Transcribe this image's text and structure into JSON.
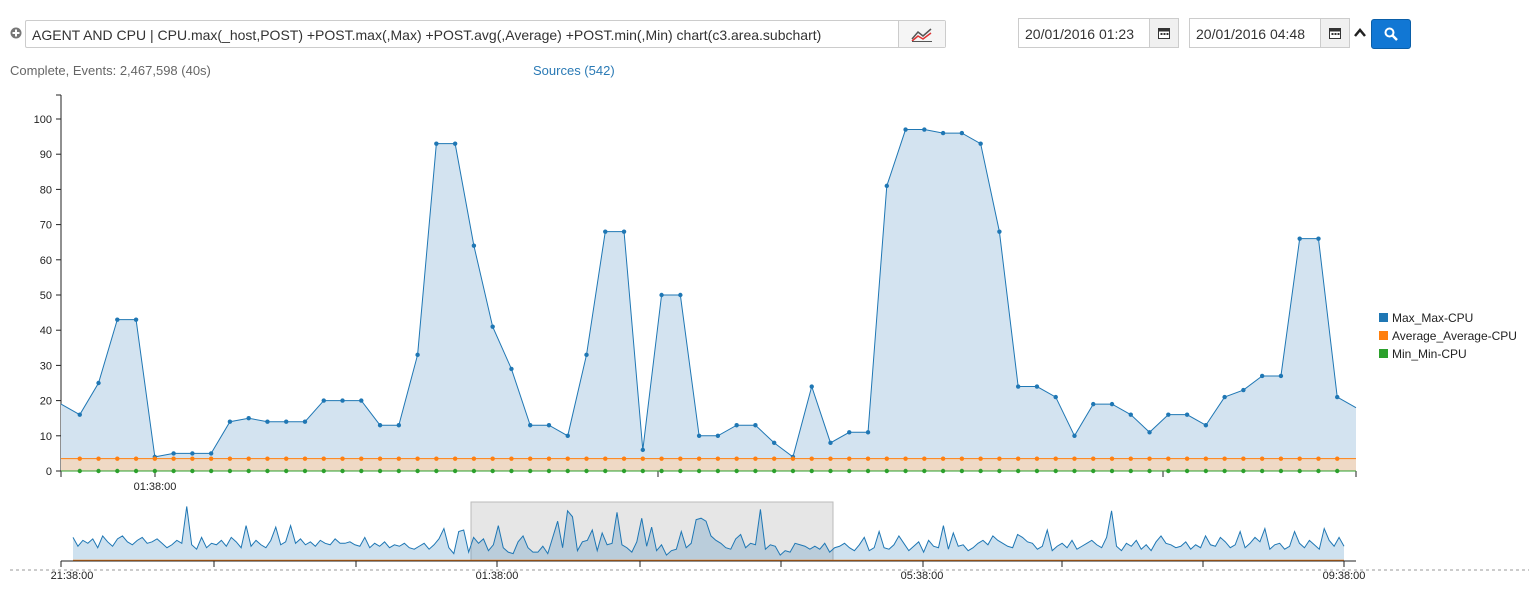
{
  "query": {
    "text": "AGENT AND CPU | CPU.max(_host,POST) +POST.max(,Max) +POST.avg(,Average) +POST.min(,Min) chart(c3.area.subchart)"
  },
  "date_range": {
    "start": "20/01/2016 01:23",
    "end": "20/01/2016 04:48"
  },
  "status": {
    "complete_text": "Complete, Events: 2,467,598 (40s)",
    "sources_link": "Sources (542)"
  },
  "colors": {
    "max": "#1f77b4",
    "avg": "#ff7f0e",
    "min": "#2ca02c",
    "max_fill": "#d3e3f0",
    "search_button": "#1177d4"
  },
  "icons": [
    "plus-circle-icon",
    "line-chart-icon",
    "calendar-icon",
    "chevron-up-icon",
    "search-icon"
  ],
  "chart_data": {
    "type": "area",
    "subchart": true,
    "ylim": [
      0,
      100
    ],
    "y_ticks": [
      0,
      10,
      20,
      30,
      40,
      50,
      60,
      70,
      80,
      90,
      100
    ],
    "x_tick_labels": [
      "01:38:00"
    ],
    "subchart_tick_labels": [
      "21:38:00",
      "01:38:00",
      "05:38:00",
      "09:38:00"
    ],
    "legend_position": "right",
    "series": [
      {
        "name": "Max_Max-CPU",
        "values": [
          19,
          16,
          25,
          43,
          43,
          4,
          5,
          5,
          5,
          14,
          15,
          14,
          14,
          14,
          20,
          20,
          20,
          13,
          13,
          33,
          93,
          93,
          64,
          41,
          29,
          13,
          13,
          10,
          33,
          68,
          68,
          6,
          50,
          50,
          10,
          10,
          13,
          13,
          8,
          4,
          24,
          8,
          11,
          11,
          81,
          97,
          97,
          96,
          96,
          93,
          68,
          24,
          24,
          21,
          10,
          19,
          19,
          16,
          11,
          16,
          16,
          13,
          21,
          23,
          27,
          27,
          66,
          66,
          21,
          18
        ]
      },
      {
        "name": "Average_Average-CPU",
        "values": [
          3.5,
          3.5,
          3.5,
          3.5,
          3.5,
          3.5,
          3.5,
          3.5,
          3.5,
          3.5,
          3.5,
          3.5,
          3.5,
          3.5,
          3.5,
          3.5,
          3.5,
          3.5,
          3.5,
          3.5,
          3.5,
          3.5,
          3.5,
          3.5,
          3.5,
          3.5,
          3.5,
          3.5,
          3.5,
          3.5,
          3.5,
          3.5,
          3.5,
          3.5,
          3.5,
          3.5,
          3.5,
          3.5,
          3.5,
          3.5,
          3.5,
          3.5,
          3.5,
          3.5,
          3.5,
          3.5,
          3.5,
          3.5,
          3.5,
          3.5,
          3.5,
          3.5,
          3.5,
          3.5,
          3.5,
          3.5,
          3.5,
          3.5,
          3.5,
          3.5,
          3.5,
          3.5,
          3.5,
          3.5,
          3.5,
          3.5,
          3.5,
          3.5,
          3.5,
          3.5
        ]
      },
      {
        "name": "Min_Min-CPU",
        "values": [
          0,
          0,
          0,
          0,
          0,
          0,
          0,
          0,
          0,
          0,
          0,
          0,
          0,
          0,
          0,
          0,
          0,
          0,
          0,
          0,
          0,
          0,
          0,
          0,
          0,
          0,
          0,
          0,
          0,
          0,
          0,
          0,
          0,
          0,
          0,
          0,
          0,
          0,
          0,
          0,
          0,
          0,
          0,
          0,
          0,
          0,
          0,
          0,
          0,
          0,
          0,
          0,
          0,
          0,
          0,
          0,
          0,
          0,
          0,
          0,
          0,
          0,
          0,
          0,
          0,
          0,
          0,
          0,
          0,
          0
        ]
      }
    ],
    "subchart_values": [
      16,
      10,
      14,
      12,
      15,
      9,
      17,
      13,
      10,
      15,
      17,
      13,
      11,
      14,
      16,
      12,
      13,
      15,
      12,
      9,
      11,
      14,
      12,
      37,
      11,
      8,
      16,
      9,
      12,
      11,
      14,
      10,
      16,
      13,
      9,
      24,
      10,
      14,
      11,
      9,
      14,
      23,
      11,
      13,
      24,
      12,
      15,
      11,
      13,
      10,
      14,
      12,
      11,
      15,
      12,
      12,
      13,
      11,
      10,
      16,
      9,
      12,
      10,
      13,
      9,
      11,
      10,
      12,
      9,
      8,
      10,
      12,
      8,
      11,
      15,
      22,
      9,
      5,
      20,
      21,
      6,
      16,
      12,
      15,
      7,
      11,
      24,
      9,
      6,
      5,
      13,
      17,
      9,
      6,
      6,
      10,
      5,
      16,
      27,
      9,
      34,
      30,
      7,
      13,
      14,
      21,
      7,
      19,
      11,
      12,
      33,
      11,
      9,
      6,
      13,
      29,
      10,
      23,
      7,
      11,
      4,
      7,
      8,
      20,
      9,
      12,
      28,
      29,
      27,
      17,
      14,
      12,
      9,
      8,
      15,
      18,
      9,
      12,
      11,
      35,
      8,
      11,
      10,
      4,
      7,
      6,
      12,
      11,
      10,
      8,
      10,
      8,
      12,
      6,
      9,
      10,
      12,
      9,
      7,
      11,
      16,
      7,
      9,
      20,
      9,
      8,
      11,
      17,
      12,
      7,
      10,
      13,
      6,
      14,
      10,
      9,
      24,
      8,
      19,
      10,
      11,
      7,
      9,
      12,
      14,
      11,
      17,
      14,
      12,
      10,
      9,
      18,
      16,
      13,
      12,
      8,
      10,
      21,
      7,
      10,
      12,
      9,
      14,
      8,
      10,
      12,
      14,
      11,
      9,
      16,
      34,
      10,
      7,
      12,
      10,
      14,
      8,
      11,
      7,
      13,
      17,
      12,
      11,
      9,
      10,
      13,
      8,
      11,
      9,
      17,
      11,
      10,
      16,
      13,
      9,
      11,
      20,
      9,
      12,
      16,
      13,
      22,
      8,
      11,
      12,
      8,
      10,
      20,
      12,
      9,
      14,
      11,
      8,
      22,
      14,
      10,
      16,
      10
    ]
  },
  "subchart_brush": {
    "from_index": 0.31,
    "to_index": 0.6
  }
}
